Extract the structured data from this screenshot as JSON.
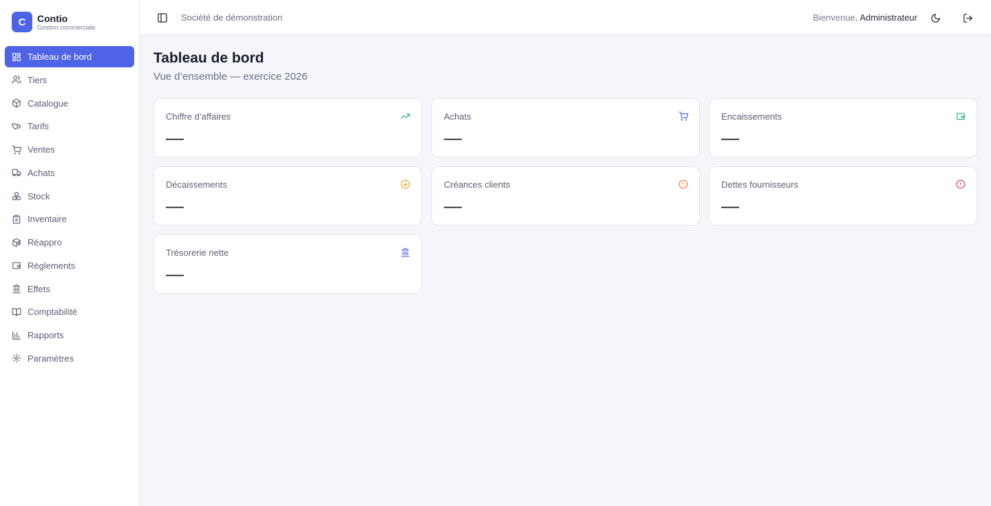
{
  "brand": {
    "logo_letter": "C",
    "name": "Contio",
    "subtitle": "Gestion commerciale"
  },
  "sidebar": {
    "items": [
      {
        "label": "Tableau de bord",
        "icon": "dashboard-icon",
        "active": true
      },
      {
        "label": "Tiers",
        "icon": "users-icon"
      },
      {
        "label": "Catalogue",
        "icon": "package-icon"
      },
      {
        "label": "Tarifs",
        "icon": "tags-icon"
      },
      {
        "label": "Ventes",
        "icon": "cart-icon"
      },
      {
        "label": "Achats",
        "icon": "truck-icon"
      },
      {
        "label": "Stock",
        "icon": "boxes-icon"
      },
      {
        "label": "Inventaire",
        "icon": "clipboard-icon"
      },
      {
        "label": "Réappro",
        "icon": "package-refresh-icon"
      },
      {
        "label": "Règlements",
        "icon": "wallet-icon"
      },
      {
        "label": "Effets",
        "icon": "bank-icon"
      },
      {
        "label": "Comptabilité",
        "icon": "book-icon"
      },
      {
        "label": "Rapports",
        "icon": "bar-chart-icon"
      },
      {
        "label": "Paramètres",
        "icon": "gear-icon"
      }
    ]
  },
  "header": {
    "company": "Société de démonstration",
    "welcome_prefix": "Bienvenue,",
    "user": "Administrateur"
  },
  "main": {
    "title": "Tableau de bord",
    "subtitle": "Vue d’ensemble — exercice 2026",
    "cards": [
      {
        "label": "Chiffre d’affaires",
        "value": "—",
        "icon": "trending-up-icon",
        "color": "#22b07d"
      },
      {
        "label": "Achats",
        "value": "—",
        "icon": "cart-icon",
        "color": "#4f63e6"
      },
      {
        "label": "Encaissements",
        "value": "—",
        "icon": "wallet-icon",
        "color": "#22b07d"
      },
      {
        "label": "Décaissements",
        "value": "—",
        "icon": "arrow-down-circle-icon",
        "color": "#f0a020"
      },
      {
        "label": "Créances clients",
        "value": "—",
        "icon": "alert-circle-icon",
        "color": "#f07a2a"
      },
      {
        "label": "Dettes fournisseurs",
        "value": "—",
        "icon": "alert-circle-icon",
        "color": "#e53935"
      },
      {
        "label": "Trésorerie nette",
        "value": "—",
        "icon": "bank-icon",
        "color": "#4f63e6"
      }
    ]
  },
  "colors": {
    "accent": "#4f63e6",
    "background": "#f5f6fa"
  }
}
